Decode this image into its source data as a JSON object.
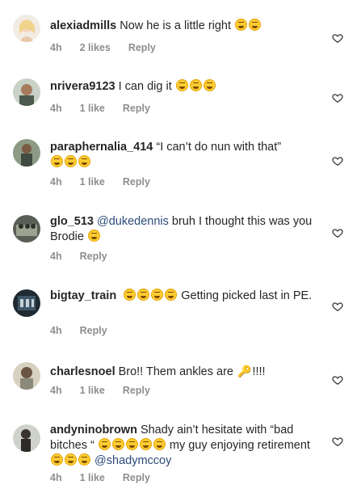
{
  "comments": [
    {
      "username": "alexiadmills",
      "text": "Now he is a little right",
      "time": "4h",
      "likes": "2 likes",
      "reply": "Reply"
    },
    {
      "username": "nrivera9123",
      "text": "I can dig it",
      "time": "4h",
      "likes": "1 like",
      "reply": "Reply"
    },
    {
      "username": "paraphernalia_414",
      "text": "“I can’t do nun with that”",
      "time": "4h",
      "likes": "1 like",
      "reply": "Reply"
    },
    {
      "username": "glo_513",
      "mention": "@dukedennis",
      "text": " bruh I thought this was you Brodie",
      "time": "4h",
      "reply": "Reply"
    },
    {
      "username": "bigtay_train",
      "text": "Getting picked last in PE.",
      "time": "4h",
      "reply": "Reply"
    },
    {
      "username": "charlesnoel",
      "text": "Bro!! Them ankles are",
      "text_after": "!!!!",
      "time": "4h",
      "likes": "1 like",
      "reply": "Reply"
    },
    {
      "username": "andyninobrown",
      "text": "Shady ain’t hesitate with “bad bitches “",
      "text2": "my guy enjoying retirement",
      "mention": "@shadymccoy",
      "time": "4h",
      "likes": "1 like",
      "reply": "Reply"
    }
  ],
  "colors": {
    "text": "#262626",
    "meta": "#8e8e8e",
    "mention": "#2c4a7a",
    "emoji": "#ffcc33"
  },
  "icons": [
    "heart-outline-icon",
    "face-with-tears-of-joy-emoji",
    "key-emoji"
  ]
}
